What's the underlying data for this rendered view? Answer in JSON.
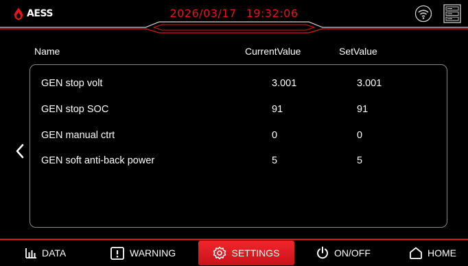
{
  "header": {
    "brand": "AESS",
    "date": "2026/03/17",
    "time": "19:32:06",
    "accent_color": "#e8141b",
    "icons": [
      "wifi-icon",
      "server-icon"
    ]
  },
  "table": {
    "columns": [
      "Name",
      "CurrentValue",
      "SetValue"
    ],
    "rows": [
      {
        "name": "GEN stop volt",
        "current": "3.001",
        "set": "3.001"
      },
      {
        "name": "GEN stop SOC",
        "current": "91",
        "set": "91"
      },
      {
        "name": "GEN manual ctrt",
        "current": "0",
        "set": "0"
      },
      {
        "name": "GEN soft anti-back power",
        "current": "5",
        "set": "5"
      }
    ]
  },
  "nav": {
    "items": [
      {
        "label": "DATA",
        "icon": "bar-chart-icon"
      },
      {
        "label": "WARNING",
        "icon": "warning-icon"
      },
      {
        "label": "SETTINGS",
        "icon": "gear-icon",
        "active": true
      },
      {
        "label": "ON/OFF",
        "icon": "power-icon"
      },
      {
        "label": "HOME",
        "icon": "home-icon"
      }
    ]
  }
}
